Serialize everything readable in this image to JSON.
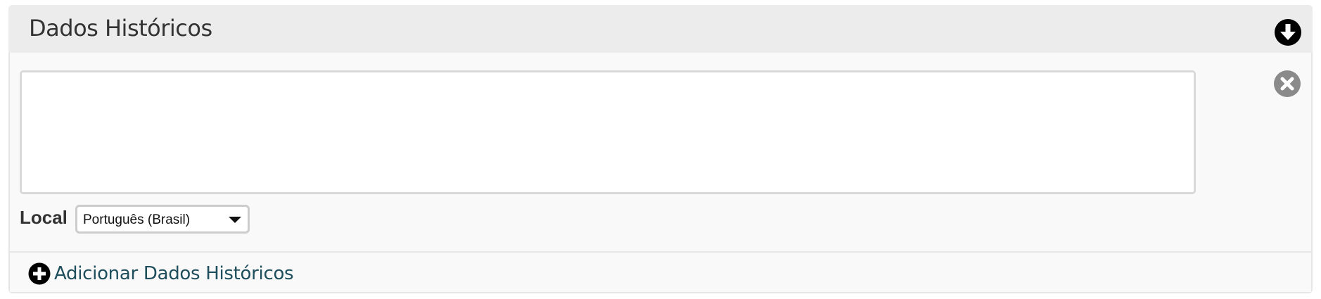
{
  "section": {
    "title": "Dados Históricos",
    "collapse_icon": "arrow-down-circle-icon"
  },
  "entry": {
    "text_value": "",
    "remove_icon": "close-circle-icon",
    "local_label": "Local",
    "locale_selected": "Português (Brasil)"
  },
  "footer": {
    "add_label": "Adicionar Dados Históricos",
    "add_icon": "plus-circle-icon"
  }
}
